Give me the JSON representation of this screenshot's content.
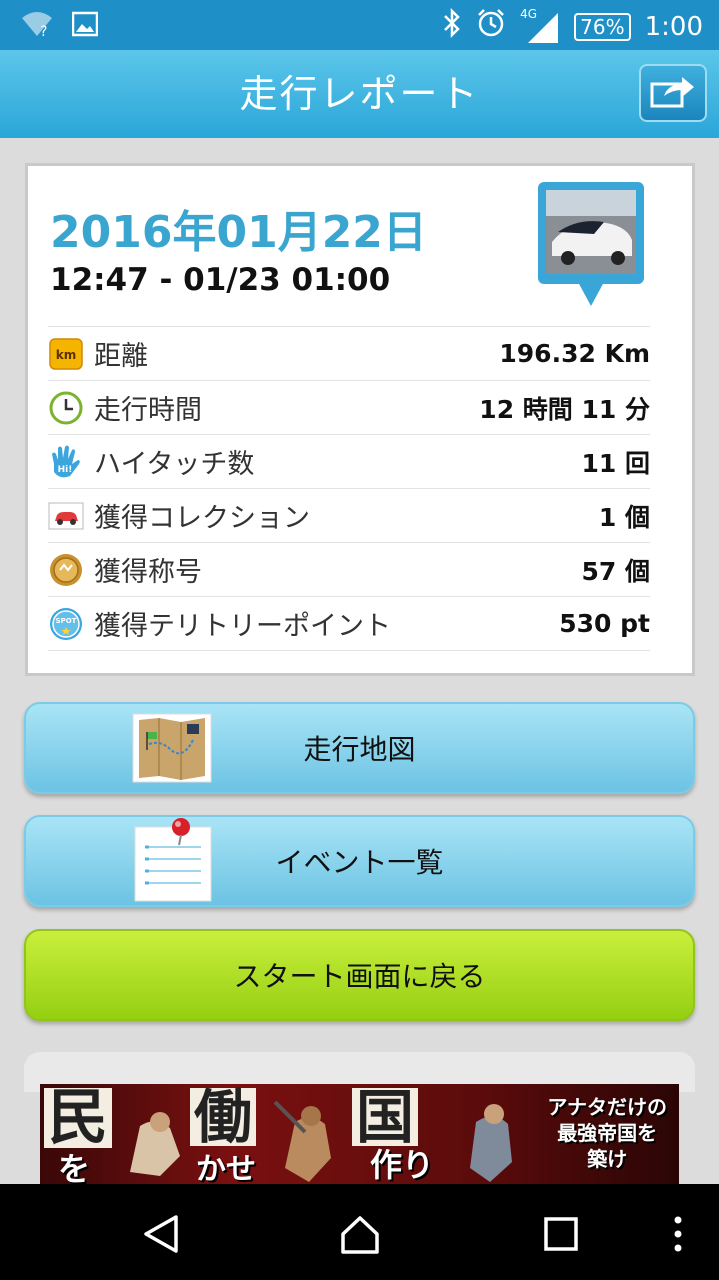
{
  "statusbar": {
    "network": "4G",
    "battery": "76%",
    "time": "1:00",
    "icons": [
      "wifi-question-icon",
      "image-icon",
      "bluetooth-icon",
      "alarm-icon",
      "signal-icon",
      "battery-icon"
    ]
  },
  "header": {
    "title": "走行レポート",
    "share_icon": "share-icon"
  },
  "report": {
    "date": "2016年01月22日",
    "time_range": "12:47 - 01/23 01:00",
    "rows": [
      {
        "label": "距離",
        "value": "196.32 Km",
        "icon": "km-icon",
        "icon_text": "km"
      },
      {
        "label": "走行時間",
        "value": "12 時間 11 分",
        "icon": "clock-icon"
      },
      {
        "label": "ハイタッチ数",
        "value": "11 回",
        "icon": "hi-hand-icon",
        "icon_text": "Hi!"
      },
      {
        "label": "獲得コレクション",
        "value": "1 個",
        "icon": "car-card-icon"
      },
      {
        "label": "獲得称号",
        "value": "57 個",
        "icon": "medal-icon"
      },
      {
        "label": "獲得テリトリーポイント",
        "value": "530 pt",
        "icon": "spot-icon",
        "icon_text": "SPOT"
      }
    ]
  },
  "buttons": {
    "map": "走行地図",
    "events": "イベント一覧",
    "back_to_start": "スタート画面に戻る"
  },
  "ad": {
    "big1": "民",
    "small1": "を",
    "big2": "働",
    "small2": "かせ",
    "big3": "国",
    "small3": "作り",
    "copy_line1": "アナタだけの",
    "copy_line2": "最強帝国を",
    "copy_line3": "築け"
  },
  "colors": {
    "statusbar": "#1f8fc8",
    "header": "#2aa6d8",
    "date": "#3aa6cf",
    "button_blue": "#6cc3e3",
    "button_green": "#95cf12"
  }
}
